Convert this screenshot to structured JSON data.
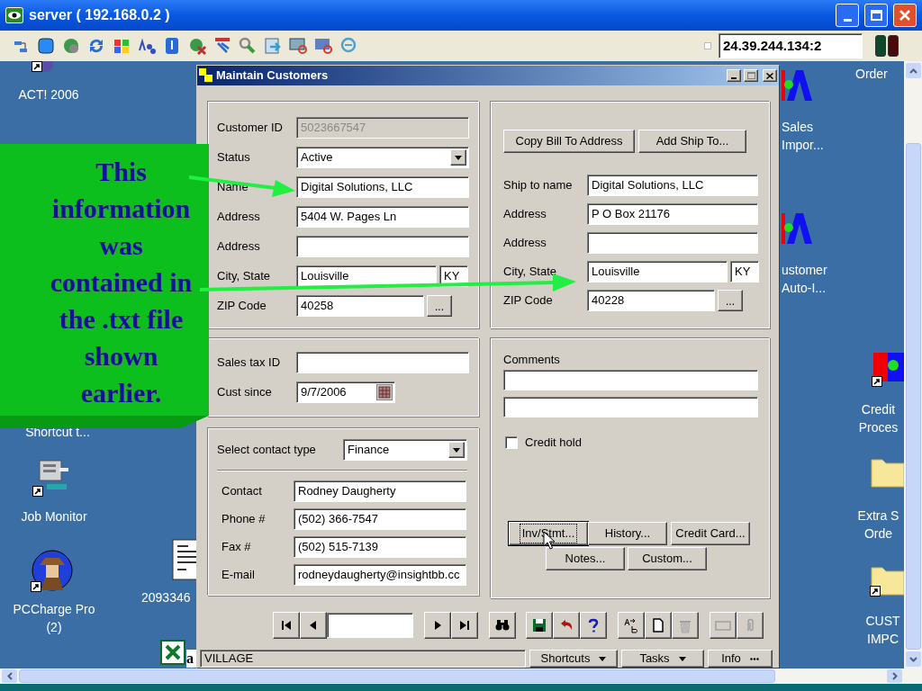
{
  "window": {
    "title": "server ( 192.168.0.2 )"
  },
  "toolbar": {
    "address": "24.39.244.134:2"
  },
  "desktop_icons": [
    {
      "kind": "act",
      "shortcut": true,
      "label": [
        "ACT! 2006"
      ]
    },
    {
      "kind": "none",
      "label": [
        "Shortcut t..."
      ]
    },
    {
      "kind": "job_monitor",
      "shortcut": true,
      "label": [
        "Job Monitor"
      ]
    },
    {
      "kind": "pccharge",
      "shortcut": true,
      "label": [
        "PCCharge Pro",
        "(2)"
      ]
    },
    {
      "kind": "document",
      "shortcut": false,
      "label": [
        "2093346"
      ]
    },
    {
      "kind": "excel",
      "shortcut": false,
      "label": [
        "a"
      ]
    },
    {
      "kind": "none",
      "label": [
        "Order"
      ]
    },
    {
      "kind": "app",
      "shortcut": false,
      "label": [
        "Sales",
        "Impor..."
      ]
    },
    {
      "kind": "app",
      "shortcut": false,
      "label": [
        "ustomer",
        "Auto-I..."
      ]
    },
    {
      "kind": "credit",
      "shortcut": true,
      "label": [
        "Credit",
        "Proces"
      ]
    },
    {
      "kind": "folder",
      "shortcut": false,
      "label": [
        "Extra S",
        "Orde"
      ]
    },
    {
      "kind": "folder",
      "shortcut": true,
      "label": [
        "CUST",
        "IMPC"
      ]
    }
  ],
  "customer_window": {
    "title": "Maintain Customers",
    "bill_to": [
      {
        "kind": "text",
        "label": "Customer ID",
        "value": "5023667547",
        "disabled": true
      },
      {
        "kind": "select",
        "label": "Status",
        "value": "Active",
        "disabled": false
      },
      {
        "kind": "text",
        "label": "Name",
        "value": "Digital Solutions, LLC",
        "disabled": false
      },
      {
        "kind": "text",
        "label": "Address",
        "value": "5404 W. Pages Ln",
        "disabled": false
      },
      {
        "kind": "text",
        "label": "Address",
        "disabled": false
      },
      {
        "kind": "city_state",
        "label": "City, State",
        "value": "Louisville",
        "state": "KY",
        "disabled": false
      },
      {
        "kind": "zip",
        "label": "ZIP Code",
        "value": "40258",
        "button": "...",
        "disabled": false
      }
    ],
    "tax": [
      {
        "kind": "text",
        "label": "Sales tax ID",
        "disabled": false
      },
      {
        "kind": "date",
        "label": "Cust since",
        "value": "9/7/2006",
        "disabled": false
      }
    ],
    "contact_type": {
      "label": "Select contact type",
      "value": "Finance"
    },
    "contact": [
      {
        "kind": "text",
        "label": "Contact",
        "value": "Rodney Daugherty",
        "disabled": false
      },
      {
        "kind": "text",
        "label": "Phone #",
        "value": "(502) 366-7547",
        "disabled": false
      },
      {
        "kind": "text",
        "label": "Fax #",
        "value": "(502) 515-7139",
        "disabled": false
      },
      {
        "kind": "text",
        "label": "E-mail",
        "value": "rodneydaugherty@insightbb.cc",
        "disabled": false
      }
    ],
    "ship_buttons": [
      "Copy Bill To Address",
      "Add Ship To..."
    ],
    "ship_to": [
      {
        "kind": "text",
        "label": "Ship to name",
        "value": "Digital Solutions, LLC",
        "disabled": false
      },
      {
        "kind": "text",
        "label": "Address",
        "value": "P O Box 21176",
        "disabled": false
      },
      {
        "kind": "text",
        "label": "Address",
        "disabled": false
      },
      {
        "kind": "city_state",
        "label": "City, State",
        "value": "Louisville",
        "state": "KY",
        "disabled": false
      },
      {
        "kind": "zip",
        "label": "ZIP Code",
        "value": "40228",
        "button": "...",
        "disabled": false
      }
    ],
    "comments": {
      "label": "Comments"
    },
    "credit_hold": {
      "label": "Credit hold",
      "checked": false
    },
    "action_buttons": [
      {
        "label": "Inv/Stmt...",
        "focused": true
      },
      {
        "label": "History...",
        "focused": false
      },
      {
        "label": "Credit Card...",
        "focused": false
      },
      {
        "label": "Notes...",
        "focused": false
      },
      {
        "label": "Custom...",
        "focused": false
      }
    ],
    "record_tools": [
      {
        "kind": "find",
        "disabled": false
      },
      {
        "kind": "save",
        "disabled": false
      },
      {
        "kind": "undo",
        "disabled": false
      },
      {
        "kind": "help",
        "disabled": false
      },
      {
        "kind": "spell",
        "disabled": false
      },
      {
        "kind": "new",
        "disabled": false
      },
      {
        "kind": "delete",
        "disabled": true
      },
      {
        "kind": "frame",
        "disabled": true
      },
      {
        "kind": "attach",
        "disabled": true
      }
    ],
    "status_bar": {
      "location": "VILLAGE",
      "menus": [
        {
          "label": "Shortcuts",
          "kind": "dropdown"
        },
        {
          "label": "Tasks",
          "kind": "dropdown"
        },
        {
          "label": "Info",
          "kind": "more"
        }
      ]
    }
  },
  "callout": {
    "text": "This information was contained in the .txt file shown earlier."
  }
}
